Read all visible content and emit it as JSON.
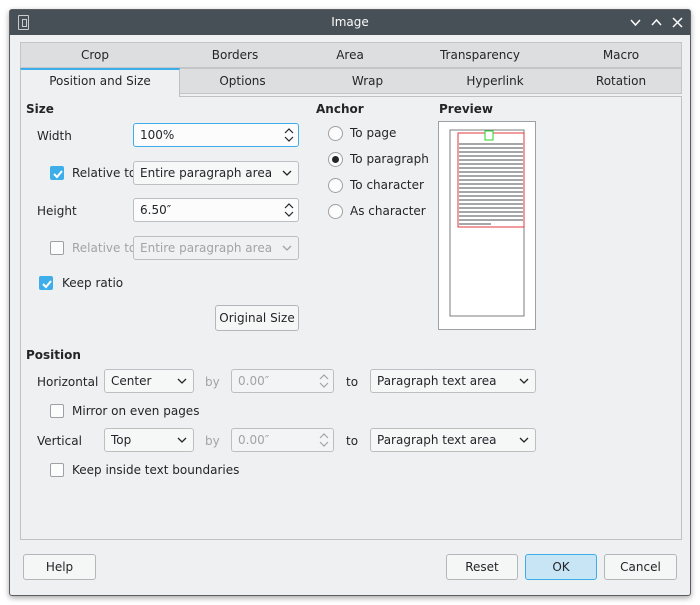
{
  "window": {
    "title": "Image"
  },
  "tabs": {
    "row1": [
      "Crop",
      "Borders",
      "Area",
      "Transparency",
      "Macro"
    ],
    "row2": [
      "Position and Size",
      "Options",
      "Wrap",
      "Hyperlink",
      "Rotation"
    ],
    "active": "Position and Size"
  },
  "size": {
    "heading": "Size",
    "width_label": "Width",
    "width_value": "100%",
    "rel_width_label": "Relative to",
    "rel_width_checked": true,
    "rel_width_value": "Entire paragraph area",
    "height_label": "Height",
    "height_value": "6.50″",
    "rel_height_label": "Relative to",
    "rel_height_checked": false,
    "rel_height_value": "Entire paragraph area",
    "keep_ratio_label": "Keep ratio",
    "keep_ratio_checked": true,
    "original_size_label": "Original Size"
  },
  "anchor": {
    "heading": "Anchor",
    "options": [
      "To page",
      "To paragraph",
      "To character",
      "As character"
    ],
    "selected": "To paragraph"
  },
  "preview": {
    "heading": "Preview"
  },
  "position": {
    "heading": "Position",
    "horizontal_label": "Horizontal",
    "horizontal_value": "Center",
    "h_by_label": "by",
    "h_by_value": "0.00″",
    "h_to_label": "to",
    "h_to_value": "Paragraph text area",
    "mirror_label": "Mirror on even pages",
    "mirror_checked": false,
    "vertical_label": "Vertical",
    "vertical_value": "Top",
    "v_by_label": "by",
    "v_by_value": "0.00″",
    "v_to_label": "to",
    "v_to_value": "Paragraph text area",
    "keep_inside_label": "Keep inside text boundaries",
    "keep_inside_checked": false
  },
  "footer": {
    "help_label": "Help",
    "reset_label": "Reset",
    "ok_label": "OK",
    "cancel_label": "Cancel"
  },
  "colors": {
    "accent": "#3daee9",
    "titlebar": "#475057",
    "preview_frame": "#e0373c",
    "preview_anchor": "#2bd12b"
  }
}
